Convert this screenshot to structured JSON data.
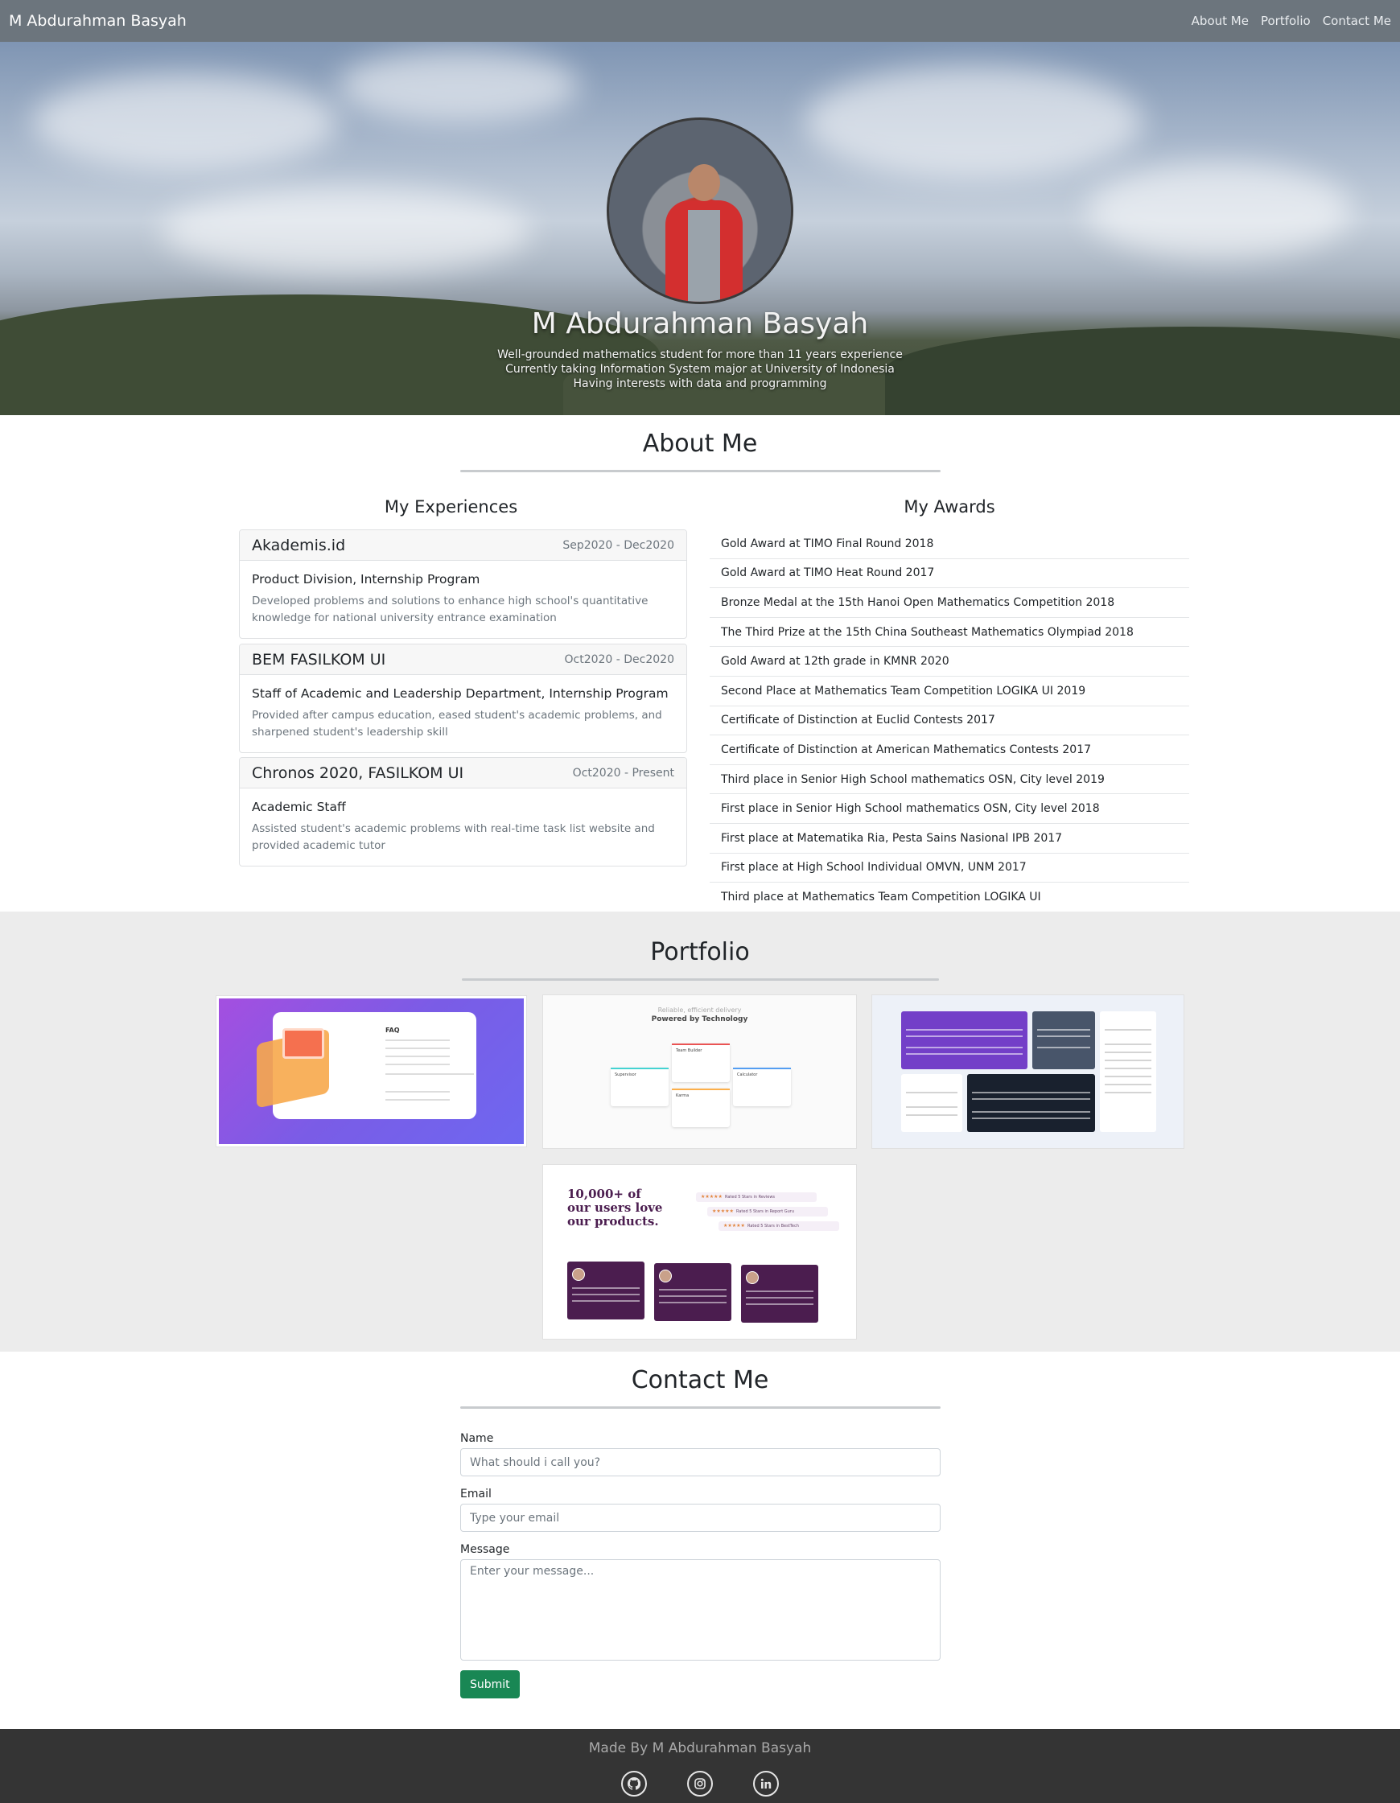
{
  "navbar": {
    "brand": "M Abdurahman Basyah",
    "links": [
      "About Me",
      "Portfolio",
      "Contact Me"
    ]
  },
  "hero": {
    "name": "M Abdurahman Basyah",
    "lines": [
      "Well-grounded mathematics student for more than 11 years experience",
      "Currently taking Information System major at University of Indonesia",
      "Having interests with data and programming"
    ]
  },
  "about": {
    "title": "About Me",
    "experiences_title": "My Experiences",
    "awards_title": "My Awards",
    "experiences": [
      {
        "org": "Akademis.id",
        "date": "Sep2020 - Dec2020",
        "role": "Product Division, Internship Program",
        "desc": "Developed problems and solutions to enhance high school's quantitative knowledge for national university entrance examination"
      },
      {
        "org": "BEM FASILKOM UI",
        "date": "Oct2020 - Dec2020",
        "role": "Staff of Academic and Leadership Department, Internship Program",
        "desc": "Provided after campus education, eased student's academic problems, and sharpened student's leadership skill"
      },
      {
        "org": "Chronos 2020, FASILKOM UI",
        "date": "Oct2020 - Present",
        "role": "Academic Staff",
        "desc": "Assisted student's academic problems with real-time task list website and provided academic tutor"
      }
    ],
    "awards": [
      "Gold Award at TIMO Final Round 2018",
      "Gold Award at TIMO Heat Round 2017",
      "Bronze Medal at the 15th Hanoi Open Mathematics Competition 2018",
      "The Third Prize at the 15th China Southeast Mathematics Olympiad 2018",
      "Gold Award at 12th grade in KMNR 2020",
      "Second Place at Mathematics Team Competition LOGIKA UI 2019",
      "Certificate of Distinction at Euclid Contests 2017",
      "Certificate of Distinction at American Mathematics Contests 2017",
      "Third place in Senior High School mathematics OSN, City level 2019",
      "First place in Senior High School mathematics OSN, City level 2018",
      "First place at Matematika Ria, Pesta Sains Nasional IPB 2017",
      "First place at High School Individual OMVN, UNM 2017",
      "Third place at Mathematics Team Competition LOGIKA UI"
    ]
  },
  "portfolio": {
    "title": "Portfolio",
    "thumb1": {
      "heading": "FAQ"
    },
    "thumb2": {
      "subtitle": "Reliable, efficient delivery",
      "title": "Powered by Technology",
      "cards": [
        "Supervisor",
        "Team Builder",
        "Karma",
        "Calculator"
      ]
    },
    "thumb4": {
      "headline": "10,000+ of our users love our products.",
      "stars": "★★★★★",
      "ratings": [
        "Rated 5 Stars in Reviews",
        "Rated 5 Stars in Report Guru",
        "Rated 5 Stars in BestTech"
      ]
    }
  },
  "contact": {
    "title": "Contact Me",
    "name_label": "Name",
    "name_placeholder": "What should i call you?",
    "email_label": "Email",
    "email_placeholder": "Type your email",
    "message_label": "Message",
    "message_placeholder": "Enter your message...",
    "submit_label": "Submit"
  },
  "footer": {
    "text": "Made By M Abdurahman Basyah",
    "icons": [
      "github-icon",
      "instagram-icon",
      "linkedin-icon"
    ]
  },
  "colors": {
    "navbar": "#6c757d",
    "submit": "#198754",
    "footer": "#343434",
    "portfolio_bg": "#ececec"
  }
}
